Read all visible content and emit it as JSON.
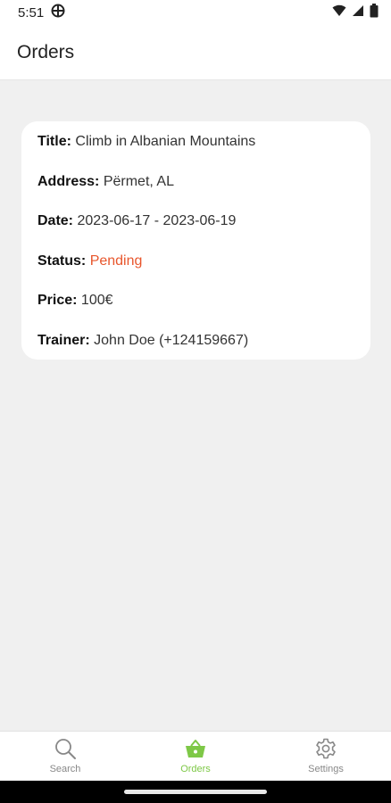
{
  "status_bar": {
    "time": "5:51"
  },
  "header": {
    "title": "Orders"
  },
  "order": {
    "title_label": "Title:",
    "title_value": "Climb in Albanian Mountains",
    "address_label": "Address:",
    "address_value": "Përmet, AL",
    "date_label": "Date:",
    "date_value": "2023-06-17 - 2023-06-19",
    "status_label": "Status:",
    "status_value": "Pending",
    "price_label": "Price:",
    "price_value": "100€",
    "trainer_label": "Trainer:",
    "trainer_value": "John Doe (+124159667)"
  },
  "nav": {
    "search_label": "Search",
    "orders_label": "Orders",
    "settings_label": "Settings",
    "active": "orders"
  },
  "colors": {
    "accent": "#7ec847",
    "status_pending": "#e8562c",
    "inactive_icon": "#888888"
  }
}
